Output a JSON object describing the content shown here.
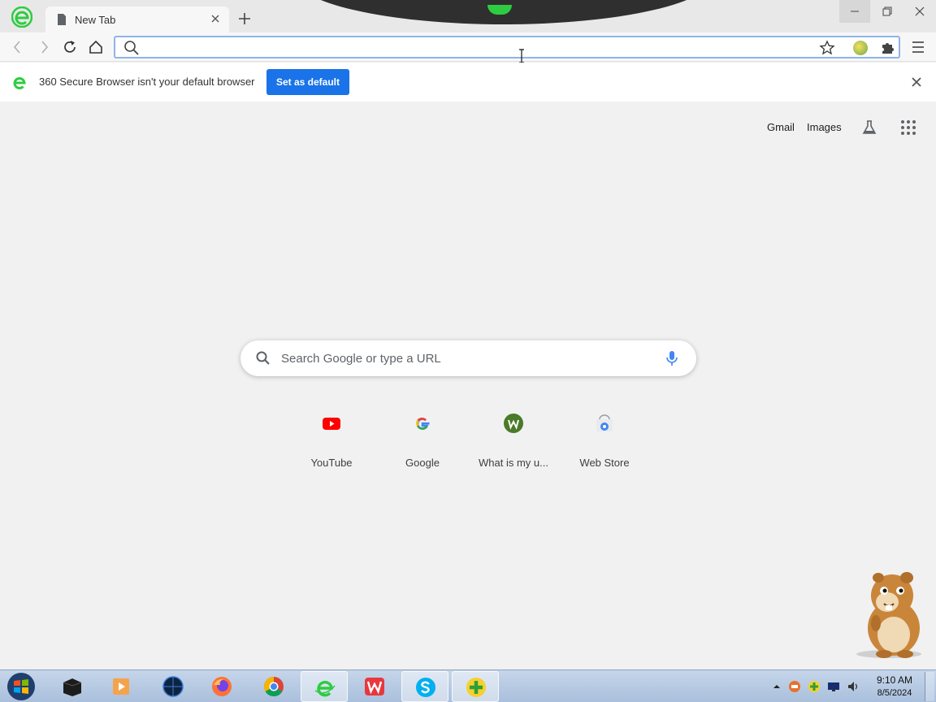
{
  "browser": {
    "tab": {
      "title": "New Tab"
    },
    "omnibox": {
      "value": "",
      "placeholder": ""
    }
  },
  "infobar": {
    "message": "360 Secure Browser isn't your default browser",
    "button_label": "Set as default"
  },
  "ntp": {
    "top_links": {
      "gmail": "Gmail",
      "images": "Images"
    },
    "search": {
      "placeholder": "Search Google or type a URL"
    },
    "shortcuts": [
      {
        "label": "YouTube",
        "icon": "youtube-icon"
      },
      {
        "label": "Google",
        "icon": "google-icon"
      },
      {
        "label": "What is my u...",
        "icon": "whatismy-icon"
      },
      {
        "label": "Web Store",
        "icon": "web-store-icon"
      }
    ]
  },
  "taskbar": {
    "apps": [
      "file-explorer-icon",
      "media-player-icon",
      "globe-browser-icon",
      "firefox-icon",
      "chrome-icon",
      "360-browser-icon",
      "wps-office-icon",
      "skype-icon",
      "360-security-icon"
    ],
    "active_app": "360-browser-icon",
    "clock": {
      "time": "9:10 AM",
      "date": "8/5/2024"
    }
  },
  "colors": {
    "accent": "#1a73e8",
    "brand_green": "#2ecc40"
  }
}
